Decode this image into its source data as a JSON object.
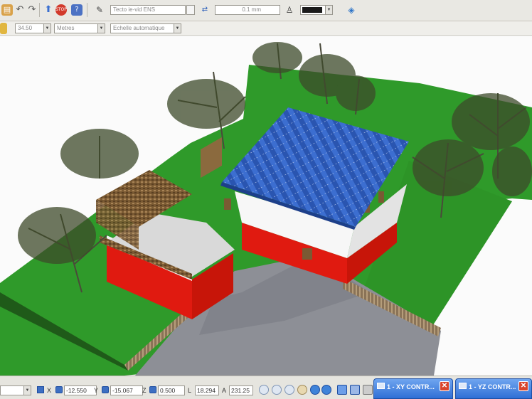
{
  "toolbar": {
    "layer_field": "Tecto ie-vid ENS",
    "width_field": "0.1 mm",
    "color_swatch": "#1a1a1a"
  },
  "toolbar2": {
    "scale_field": "34.50",
    "units_select": "Metres",
    "scale_mode_select": "Echelle automatique"
  },
  "status": {
    "x_label": "X",
    "x_value": "-12.550",
    "y_label": "Y",
    "y_value": "-15.067",
    "z_label": "Z",
    "z_value": "0.500",
    "l_label": "L",
    "l_value": "18.294",
    "a_label": "A",
    "a_value": "231.25"
  },
  "windows": {
    "xy": "1 - XY CONTR...",
    "yz": "1 - YZ CONTR..."
  },
  "icons": {
    "close": "✕"
  },
  "colors": {
    "grass": "#2f9a2a",
    "roof_blue": "#2a55b0",
    "wall_red": "#e01a10",
    "pavement": "#8d8f96"
  }
}
